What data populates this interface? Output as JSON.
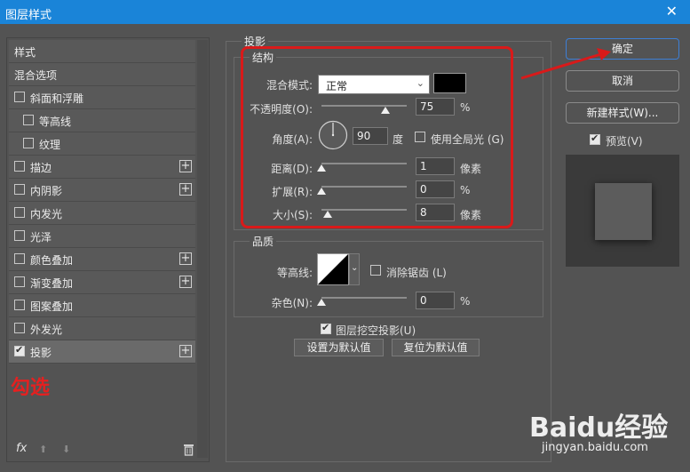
{
  "window": {
    "title": "图层样式",
    "close": "✕"
  },
  "sidebar": {
    "items": [
      {
        "label": "样式",
        "checkbox": false,
        "checked": false,
        "plus": false,
        "indent": 0
      },
      {
        "label": "混合选项",
        "checkbox": false,
        "checked": false,
        "plus": false,
        "indent": 0
      },
      {
        "label": "斜面和浮雕",
        "checkbox": true,
        "checked": false,
        "plus": false,
        "indent": 0
      },
      {
        "label": "等高线",
        "checkbox": true,
        "checked": false,
        "plus": false,
        "indent": 1
      },
      {
        "label": "纹理",
        "checkbox": true,
        "checked": false,
        "plus": false,
        "indent": 1
      },
      {
        "label": "描边",
        "checkbox": true,
        "checked": false,
        "plus": true,
        "indent": 0
      },
      {
        "label": "内阴影",
        "checkbox": true,
        "checked": false,
        "plus": true,
        "indent": 0
      },
      {
        "label": "内发光",
        "checkbox": true,
        "checked": false,
        "plus": false,
        "indent": 0
      },
      {
        "label": "光泽",
        "checkbox": true,
        "checked": false,
        "plus": false,
        "indent": 0
      },
      {
        "label": "颜色叠加",
        "checkbox": true,
        "checked": false,
        "plus": true,
        "indent": 0
      },
      {
        "label": "渐变叠加",
        "checkbox": true,
        "checked": false,
        "plus": true,
        "indent": 0
      },
      {
        "label": "图案叠加",
        "checkbox": true,
        "checked": false,
        "plus": false,
        "indent": 0
      },
      {
        "label": "外发光",
        "checkbox": true,
        "checked": false,
        "plus": false,
        "indent": 0
      },
      {
        "label": "投影",
        "checkbox": true,
        "checked": true,
        "plus": true,
        "indent": 0
      }
    ],
    "annotation": "勾选",
    "fx_label": "fx"
  },
  "panel": {
    "title": "投影",
    "structure": {
      "title": "结构",
      "blend_mode_label": "混合模式:",
      "blend_mode_value": "正常",
      "blend_color": "#000000",
      "opacity_label": "不透明度(O):",
      "opacity_value": "75",
      "opacity_unit": "%",
      "angle_label": "角度(A):",
      "angle_value": "90",
      "angle_unit": "度",
      "global_light_label": "使用全局光 (G)",
      "distance_label": "距离(D):",
      "distance_value": "1",
      "distance_unit": "像素",
      "spread_label": "扩展(R):",
      "spread_value": "0",
      "spread_unit": "%",
      "size_label": "大小(S):",
      "size_value": "8",
      "size_unit": "像素"
    },
    "quality": {
      "title": "品质",
      "contour_label": "等高线:",
      "antialias_label": "消除锯齿 (L)",
      "noise_label": "杂色(N):",
      "noise_value": "0",
      "noise_unit": "%"
    },
    "knockout_label": "图层挖空投影(U)",
    "set_default": "设置为默认值",
    "reset_default": "复位为默认值"
  },
  "right": {
    "ok": "确定",
    "cancel": "取消",
    "new_style": "新建样式(W)...",
    "preview_label": "预览(V)"
  },
  "watermark": {
    "brand": "Baidu经验",
    "url": "jingyan.baidu.com"
  },
  "colors": {
    "accent_red": "#d91a1a",
    "titlebar": "#1a84d8"
  }
}
